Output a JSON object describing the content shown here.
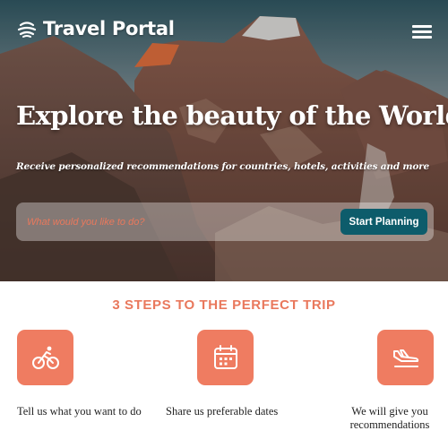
{
  "header": {
    "brand_name": "Travel Portal",
    "logo_icon": "globe-logo-icon",
    "menu_icon": "hamburger-menu-icon"
  },
  "hero": {
    "title": "Explore the beauty of the World",
    "subtitle": "Receive personalized recommendations for countries, hotels, activities and more",
    "search": {
      "placeholder": "What would you like to do?",
      "value": "",
      "button_label": "Start Planning"
    }
  },
  "steps": {
    "title": "3 STEPS TO THE PERFECT TRIP",
    "items": [
      {
        "icon": "cycling-icon",
        "label": "Tell us what you want to do"
      },
      {
        "icon": "calendar-icon",
        "label": "Share us preferable dates"
      },
      {
        "icon": "plane-landing-icon",
        "label": "We will give you recommendations"
      }
    ]
  },
  "colors": {
    "accent": "#ef7c61",
    "accent_text": "#e9785c",
    "button": "#0d5c6b"
  }
}
